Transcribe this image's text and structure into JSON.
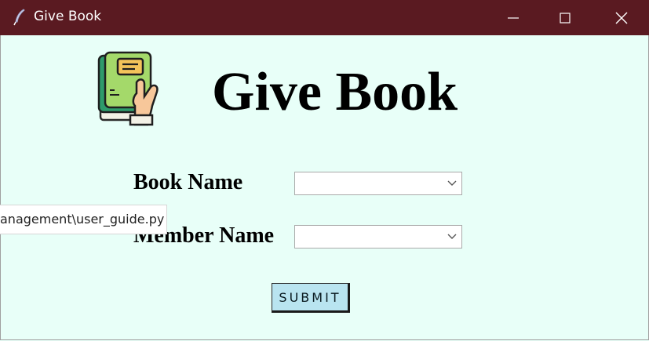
{
  "window": {
    "title": "Give Book",
    "titlebar_color": "#5a1a21",
    "background": "#e8fff8"
  },
  "header": {
    "title": "Give Book",
    "icon": "book-in-hand-icon"
  },
  "form": {
    "book_name_label": "Book Name",
    "book_name_value": "",
    "member_name_label": "Member Name",
    "member_name_value": "",
    "submit_label": "SUBMIT",
    "submit_color": "#b9e4f0"
  },
  "tooltip": {
    "text": "anagement\\user_guide.py"
  }
}
